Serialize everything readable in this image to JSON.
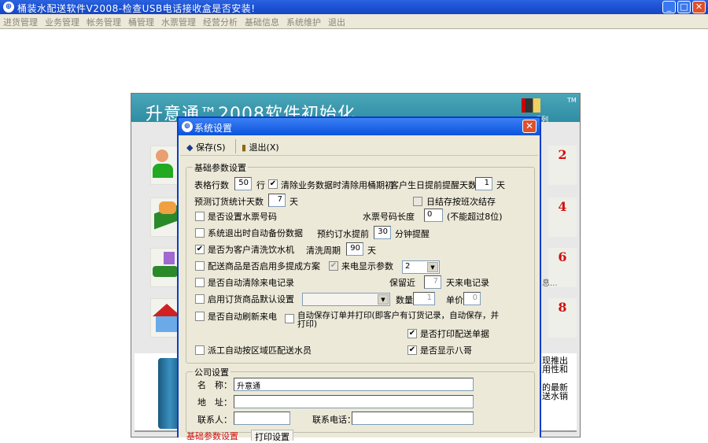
{
  "app": {
    "title": "桶装水配送软件V2008-检查USB电话接收盒是否安装!",
    "min": "_",
    "max": "□",
    "close": "✕"
  },
  "menu": [
    "进货管理",
    "业务管理",
    "帐务管理",
    "桶管理",
    "水票管理",
    "经营分析",
    "基础信息",
    "系统维护",
    "退出"
  ],
  "wizard": {
    "title": "升意通™2008软件初始化",
    "logo_tm": "TM",
    "logo_series": "系列",
    "steps": [
      "2",
      "4",
      "6",
      "8"
    ],
    "side_text": "息...",
    "desc_lines": [
      "现推出",
      "用性和",
      "的最新",
      "送水销"
    ]
  },
  "dialog": {
    "title": "系统设置",
    "toolbar": {
      "save": "保存(S)",
      "exit": "退出(X)"
    },
    "basic": {
      "legend": "基础参数设置",
      "table_rows_label": "表格行数",
      "table_rows": "50",
      "row_unit": "行",
      "clear_bucket": {
        "label": "清除业务数据时清除用桶期初",
        "checked": true
      },
      "birthday_label": "客户生日提前提醒天数",
      "birthday_days": "1",
      "day": "天",
      "forecast_label": "预测订货统计天数",
      "forecast_days": "7",
      "shift_store": {
        "label": "日结存按班次结存",
        "checked": false
      },
      "ticket_no": {
        "label": "是否设置水票号码",
        "checked": false
      },
      "ticket_len_label": "水票号码长度",
      "ticket_len": "0",
      "ticket_len_note": "(不能超过8位)",
      "auto_backup": {
        "label": "系统退出时自动备份数据",
        "checked": false
      },
      "reserve_label": "预约订水提前",
      "reserve_min": "30",
      "reserve_unit": "分钟提醒",
      "clean_machine": {
        "label": "是否为客户清洗饮水机",
        "checked": true
      },
      "clean_cycle_label": "清洗周期",
      "clean_cycle": "90",
      "multi_commission": {
        "label": "配送商品是否启用多提成方案",
        "checked": false
      },
      "caller_param": {
        "label": "来电显示参数",
        "checked": true
      },
      "caller_param_value": "2",
      "auto_clear_calls": {
        "label": "是否自动清除来电记录",
        "checked": false
      },
      "keep_label": "保留近",
      "keep_days": "7",
      "keep_unit": "天来电记录",
      "default_goods": {
        "label": "启用订货商品默认设置",
        "checked": false
      },
      "default_goods_value": "",
      "qty_label": "数量",
      "qty": "1",
      "price_label": "单价",
      "price": "0",
      "auto_refresh": {
        "label": "是否自动刷新来电",
        "checked": false
      },
      "auto_save_print": {
        "label": "自动保存订单并打印(即客户有订货记录，自动保存，并",
        "label2": "打印)",
        "checked": false
      },
      "print_delivery": {
        "label": "是否打印配送单据",
        "checked": true
      },
      "auto_dispatch": {
        "label": "派工自动按区域匹配送水员",
        "checked": false
      },
      "show_bage": {
        "label": "是否显示八哥",
        "checked": true
      }
    },
    "company": {
      "legend": "公司设置",
      "name_label": "名　称：",
      "name": "升意通",
      "addr_label": "地　址：",
      "addr": "",
      "contact_label": "联系人：",
      "contact": "",
      "phone_label": "联系电话：",
      "phone": ""
    },
    "tabs": [
      "基础参数设置",
      "打印设置"
    ]
  },
  "colors": {
    "titlebar": "#1a4fd0",
    "accent_red": "#d01010"
  }
}
